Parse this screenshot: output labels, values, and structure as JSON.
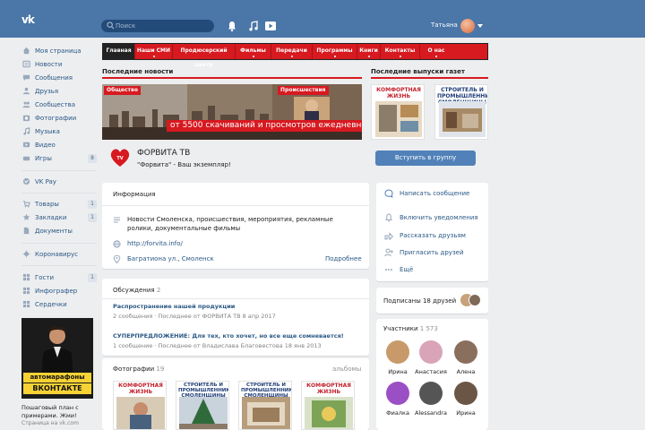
{
  "header": {
    "logo_text": "vk",
    "search_placeholder": "Поиск",
    "icons": [
      "bell-icon",
      "music-icon",
      "video-icon"
    ],
    "user_name": "Татьяна"
  },
  "left_nav": {
    "items": [
      {
        "label": "Моя страница",
        "icon": "home-icon"
      },
      {
        "label": "Новости",
        "icon": "news-icon"
      },
      {
        "label": "Сообщения",
        "icon": "messages-icon"
      },
      {
        "label": "Друзья",
        "icon": "friends-icon"
      },
      {
        "label": "Сообщества",
        "icon": "groups-icon"
      },
      {
        "label": "Фотографии",
        "icon": "photos-icon"
      },
      {
        "label": "Музыка",
        "icon": "music-icon"
      },
      {
        "label": "Видео",
        "icon": "video-icon"
      },
      {
        "label": "Игры",
        "icon": "games-icon",
        "count": "8"
      },
      {
        "label": "VK Pay",
        "icon": "vkpay-icon"
      },
      {
        "label": "Товары",
        "icon": "goods-icon",
        "count": "1"
      },
      {
        "label": "Закладки",
        "icon": "bookmarks-icon",
        "count": "1"
      },
      {
        "label": "Документы",
        "icon": "documents-icon"
      },
      {
        "label": "Коронавирус",
        "icon": "coronavirus-icon"
      },
      {
        "label": "Гости",
        "icon": "guests-icon",
        "count": "1"
      },
      {
        "label": "Инфографер",
        "icon": "infographer-icon"
      },
      {
        "label": "Сердечки",
        "icon": "hearts-icon"
      }
    ]
  },
  "ad": {
    "line1": "автомарафоны",
    "line2": "ВКОНТАКТЕ",
    "caption": "Пошаговый план с примерами. Жми!",
    "source": "Страница на vk.com"
  },
  "group_menu": {
    "items": [
      "Главная",
      "Наши СМИ",
      "Продюсерский центр",
      "Фильмы",
      "Передачи",
      "Программы",
      "Книги",
      "Контакты",
      "О нас"
    ],
    "active_index": 0
  },
  "news": {
    "title": "Последние новости",
    "tag_left": "Общество",
    "tag_right": "Происшествия",
    "promo": "от 5500 скачиваний и просмотров ежедневно!"
  },
  "papers": {
    "title": "Последние выпуски газет",
    "items": [
      "КОМФОРТНАЯ ЖИЗНЬ",
      "СТРОИТЕЛЬ И ПРОМЫШЛЕННИК СМОЛЕНЩИНЫ"
    ]
  },
  "group": {
    "name": "ФОРВИТА ТВ",
    "status": "\"Форвита\" - Ваш экземпляр!",
    "join_label": "Вступить в группу"
  },
  "info": {
    "title": "Информация",
    "description": "Новости Смоленска, происшествия, мероприятия, рекламные ролики, документальные фильмы",
    "website": "http://forvita.info/",
    "address": "Багратиона ул., Смоленск",
    "more_label": "Подробнее"
  },
  "actions": {
    "items": [
      {
        "label": "Написать сообщение",
        "icon": "message-icon"
      },
      {
        "label": "Включить уведомления",
        "icon": "bell-icon"
      },
      {
        "label": "Рассказать друзьям",
        "icon": "share-icon"
      },
      {
        "label": "Пригласить друзей",
        "icon": "invite-icon"
      },
      {
        "label": "Ещё",
        "icon": "more-icon"
      }
    ]
  },
  "discussions": {
    "title": "Обсуждения",
    "count": "2",
    "items": [
      {
        "title": "Распространение нашей продукции",
        "meta": "2 сообщения · Последнее от ФОРВИТА ТВ 8 апр 2017"
      },
      {
        "title": "СУПЕРПРЕДЛОЖЕНИЕ: Для тех, кто хочет, но все еще сомневается!",
        "meta": "1 сообщение · Последнее от Владислава Благовестова 18 янв 2013"
      }
    ]
  },
  "photos": {
    "title": "Фотографии",
    "count": "19",
    "albums_label": "альбомы",
    "items": [
      "КОМФОРТНАЯ ЖИЗНЬ",
      "СТРОИТЕЛЬ И ПРОМЫШЛЕННИК СМОЛЕНЩИНЫ",
      "СТРОИТЕЛЬ И ПРОМЫШЛЕННИК СМОЛЕНЩИНЫ",
      "КОМФОРТНАЯ ЖИЗНЬ"
    ]
  },
  "subscribed": {
    "text": "Подписаны 18 друзей"
  },
  "members": {
    "title": "Участники",
    "count": "1 573",
    "items": [
      {
        "name": "Ирина",
        "color": "#c89a6a"
      },
      {
        "name": "Анастасия",
        "color": "#d9a3b8"
      },
      {
        "name": "Алена",
        "color": "#8a6f5e"
      },
      {
        "name": "Фиалка",
        "color": "#9b4fc4"
      },
      {
        "name": "Alessandra",
        "color": "#555555"
      },
      {
        "name": "Ирина",
        "color": "#6b5646"
      }
    ]
  }
}
